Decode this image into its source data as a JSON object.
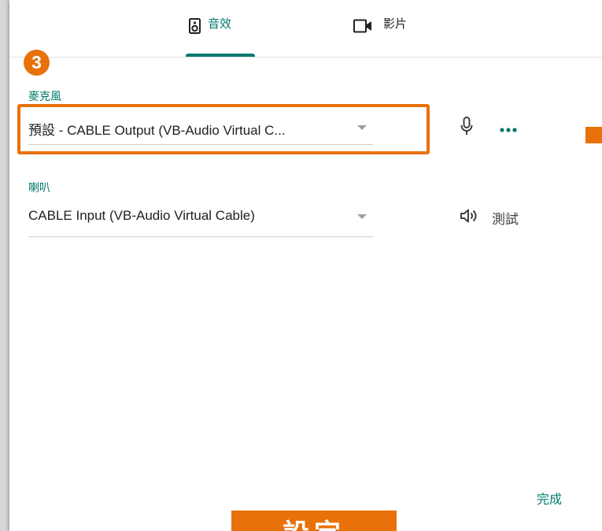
{
  "tabs": {
    "audio_label": "音效",
    "video_label": "影片"
  },
  "step_badge": "3",
  "microphone": {
    "label": "麥克風",
    "selected": "預設 - CABLE Output (VB-Audio Virtual C..."
  },
  "speaker": {
    "label": "喇叭",
    "selected": "CABLE Input (VB-Audio Virtual Cable)",
    "test_label": "測試"
  },
  "footer": {
    "done_label": "完成"
  },
  "banner_text": "設定",
  "colors": {
    "accent": "#00796b",
    "highlight": "#e8710a",
    "text": "#202124",
    "icon": "#5f6368"
  },
  "icons": {
    "audio_tab": "speaker-box-icon",
    "video_tab": "video-camera-icon",
    "mic": "microphone-icon",
    "more": "more-horizontal-icon",
    "speaker": "volume-icon"
  }
}
